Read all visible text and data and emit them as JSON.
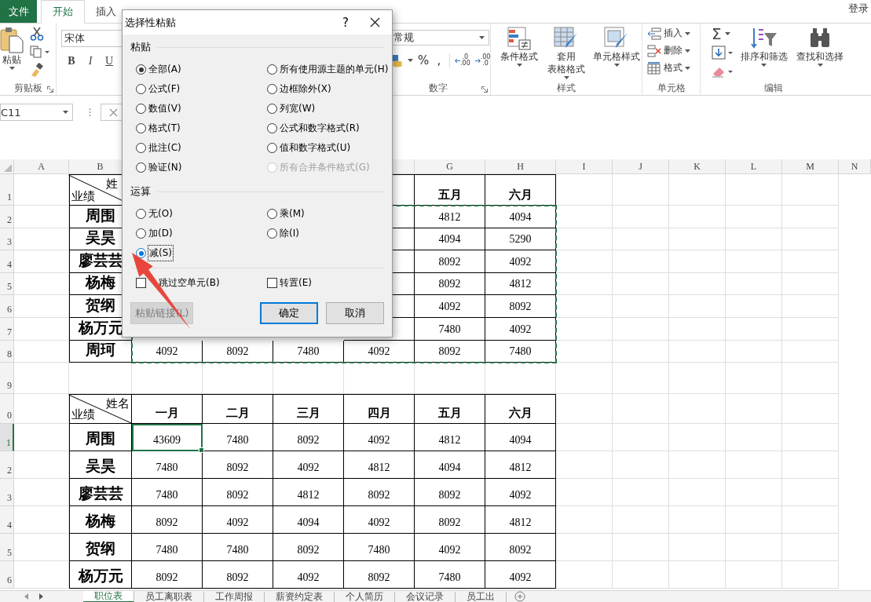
{
  "ribbon_tabs": [
    {
      "label": "文件",
      "kind": "file",
      "selected": false
    },
    {
      "label": "开始",
      "kind": "tab",
      "selected": true
    },
    {
      "label": "插入",
      "kind": "tab",
      "selected": false
    }
  ],
  "account": "登录",
  "clipboard": {
    "label": "剪贴板",
    "paste": "粘贴"
  },
  "font": {
    "family": "宋体",
    "styles": [
      "B",
      "I",
      "U"
    ]
  },
  "number": {
    "label": "数字",
    "format": "常规",
    "symbols": [
      "%",
      ","
    ],
    "decimals": [
      {
        "top": ".0",
        "bottom": ".00"
      },
      {
        "top": ".00",
        "bottom": ".0"
      }
    ]
  },
  "styles": {
    "label": "样式",
    "buttons": [
      {
        "lines": [
          "条件格式"
        ],
        "kind": "conditional"
      },
      {
        "lines": [
          "套用",
          "表格格式"
        ],
        "kind": "table"
      },
      {
        "lines": [
          "单元格样式"
        ],
        "kind": "cell"
      }
    ]
  },
  "cells": {
    "label": "单元格",
    "buttons": [
      {
        "label": "插入",
        "kind": "insert"
      },
      {
        "label": "删除",
        "kind": "delete"
      },
      {
        "label": "格式",
        "kind": "format"
      }
    ]
  },
  "editing": {
    "label": "编辑",
    "sum": "Σ",
    "buttons": [
      {
        "label": "排序和筛选",
        "kind": "sort"
      },
      {
        "label": "查找和选择",
        "kind": "find"
      }
    ]
  },
  "formula_bar": {
    "name_box": "C11"
  },
  "column_headers_left": [
    "A",
    "B"
  ],
  "column_headers_right": [
    "G",
    "H",
    "I",
    "J",
    "K",
    "L",
    "M",
    "N"
  ],
  "row_headers": [
    {
      "label": "1",
      "selected": false
    },
    {
      "label": "2",
      "selected": false
    },
    {
      "label": "3",
      "selected": false
    },
    {
      "label": "4",
      "selected": false
    },
    {
      "label": "5",
      "selected": false
    },
    {
      "label": "6",
      "selected": false
    },
    {
      "label": "7",
      "selected": false
    },
    {
      "label": "8",
      "selected": false
    },
    {
      "label": "9",
      "selected": false
    },
    {
      "label": "0",
      "selected": false
    },
    {
      "label": "1",
      "selected": true
    },
    {
      "label": "2",
      "selected": false
    },
    {
      "label": "3",
      "selected": false
    },
    {
      "label": "4",
      "selected": false
    },
    {
      "label": "5",
      "selected": false
    },
    {
      "label": "6",
      "selected": false
    }
  ],
  "tables": [
    {
      "corner_top": "姓",
      "corner_bottom": "业绩",
      "copy_marquee": true,
      "months": [
        "五月",
        "六月"
      ],
      "rows": [
        {
          "name": "周围",
          "values": [
            {
              "v": "4812",
              "selected": false
            },
            {
              "v": "4094",
              "selected": false
            }
          ]
        },
        {
          "name": "吴昊",
          "values": [
            {
              "v": "4094",
              "selected": false
            },
            {
              "v": "5290",
              "selected": false
            }
          ]
        },
        {
          "name": "廖芸芸",
          "values": [
            {
              "v": "8092",
              "selected": false
            },
            {
              "v": "4092",
              "selected": false
            }
          ]
        },
        {
          "name": "杨梅",
          "values": [
            {
              "v": "8092",
              "selected": false
            },
            {
              "v": "4812",
              "selected": false
            }
          ]
        },
        {
          "name": "贺纲",
          "values": [
            {
              "v": "4092",
              "selected": false
            },
            {
              "v": "8092",
              "selected": false
            }
          ]
        },
        {
          "name": "杨万元",
          "values": [
            {
              "v": "7480",
              "selected": false
            },
            {
              "v": "4092",
              "selected": false
            }
          ]
        },
        {
          "name": "周珂",
          "values": [
            {
              "v": "4092",
              "selected": false
            },
            {
              "v": "8092",
              "selected": false
            },
            {
              "v": "7480",
              "selected": false
            },
            {
              "v": "4092",
              "selected": false
            },
            {
              "v": "8092",
              "selected": false
            },
            {
              "v": "7480",
              "selected": false
            }
          ]
        }
      ]
    },
    {
      "corner_top": "姓名",
      "corner_bottom": "业绩",
      "copy_marquee": false,
      "months": [
        "一月",
        "二月",
        "三月",
        "四月",
        "五月",
        "六月"
      ],
      "rows": [
        {
          "name": "周围",
          "values": [
            {
              "v": "43609",
              "selected": true
            },
            {
              "v": "7480",
              "selected": false
            },
            {
              "v": "8092",
              "selected": false
            },
            {
              "v": "4092",
              "selected": false
            },
            {
              "v": "4812",
              "selected": false
            },
            {
              "v": "4094",
              "selected": false
            }
          ]
        },
        {
          "name": "吴昊",
          "values": [
            {
              "v": "7480",
              "selected": false
            },
            {
              "v": "8092",
              "selected": false
            },
            {
              "v": "4092",
              "selected": false
            },
            {
              "v": "4812",
              "selected": false
            },
            {
              "v": "4094",
              "selected": false
            },
            {
              "v": "4812",
              "selected": false
            }
          ]
        },
        {
          "name": "廖芸芸",
          "values": [
            {
              "v": "7480",
              "selected": false
            },
            {
              "v": "8092",
              "selected": false
            },
            {
              "v": "4812",
              "selected": false
            },
            {
              "v": "8092",
              "selected": false
            },
            {
              "v": "8092",
              "selected": false
            },
            {
              "v": "4092",
              "selected": false
            }
          ]
        },
        {
          "name": "杨梅",
          "values": [
            {
              "v": "8092",
              "selected": false
            },
            {
              "v": "4092",
              "selected": false
            },
            {
              "v": "4094",
              "selected": false
            },
            {
              "v": "4092",
              "selected": false
            },
            {
              "v": "8092",
              "selected": false
            },
            {
              "v": "4812",
              "selected": false
            }
          ]
        },
        {
          "name": "贺纲",
          "values": [
            {
              "v": "7480",
              "selected": false
            },
            {
              "v": "7480",
              "selected": false
            },
            {
              "v": "8092",
              "selected": false
            },
            {
              "v": "7480",
              "selected": false
            },
            {
              "v": "4092",
              "selected": false
            },
            {
              "v": "8092",
              "selected": false
            }
          ]
        },
        {
          "name": "杨万元",
          "values": [
            {
              "v": "8092",
              "selected": false
            },
            {
              "v": "8092",
              "selected": false
            },
            {
              "v": "4092",
              "selected": false
            },
            {
              "v": "8092",
              "selected": false
            },
            {
              "v": "7480",
              "selected": false
            },
            {
              "v": "4092",
              "selected": false
            }
          ]
        }
      ]
    }
  ],
  "sheet_tabs": [
    {
      "label": "职位表",
      "selected": true
    },
    {
      "label": "员工离职表",
      "selected": false
    },
    {
      "label": "工作周报",
      "selected": false
    },
    {
      "label": "薪资约定表",
      "selected": false
    },
    {
      "label": "个人简历",
      "selected": false
    },
    {
      "label": "会议记录",
      "selected": false
    },
    {
      "label": "员工出",
      "selected": false
    }
  ],
  "dialog": {
    "title": "选择性粘贴",
    "help": "?",
    "paste_section": "粘贴",
    "paste_options": [
      {
        "label": "全部(A)",
        "selected": true,
        "disabled": false
      },
      {
        "label": "所有使用源主题的单元(H)",
        "selected": false,
        "disabled": false
      },
      {
        "label": "公式(F)",
        "selected": false,
        "disabled": false
      },
      {
        "label": "边框除外(X)",
        "selected": false,
        "disabled": false
      },
      {
        "label": "数值(V)",
        "selected": false,
        "disabled": false
      },
      {
        "label": "列宽(W)",
        "selected": false,
        "disabled": false
      },
      {
        "label": "格式(T)",
        "selected": false,
        "disabled": false
      },
      {
        "label": "公式和数字格式(R)",
        "selected": false,
        "disabled": false
      },
      {
        "label": "批注(C)",
        "selected": false,
        "disabled": false
      },
      {
        "label": "值和数字格式(U)",
        "selected": false,
        "disabled": false
      },
      {
        "label": "验证(N)",
        "selected": false,
        "disabled": false
      },
      {
        "label": "所有合并条件格式(G)",
        "selected": false,
        "disabled": true
      }
    ],
    "operation_section": "运算",
    "operation_options": [
      {
        "label": "无(O)",
        "selected": false
      },
      {
        "label": "乘(M)",
        "selected": false
      },
      {
        "label": "加(D)",
        "selected": false
      },
      {
        "label": "除(I)",
        "selected": false
      },
      {
        "label": "减(S)",
        "selected": true
      }
    ],
    "checkboxes": [
      {
        "label": "跳过空单元(B)",
        "checked": false
      },
      {
        "label": "转置(E)",
        "checked": false
      }
    ],
    "buttons": [
      {
        "label": "粘贴链接(L)",
        "kind": "disabled"
      },
      {
        "label": "确定",
        "kind": "default"
      },
      {
        "label": "取消",
        "kind": "normal"
      }
    ]
  }
}
